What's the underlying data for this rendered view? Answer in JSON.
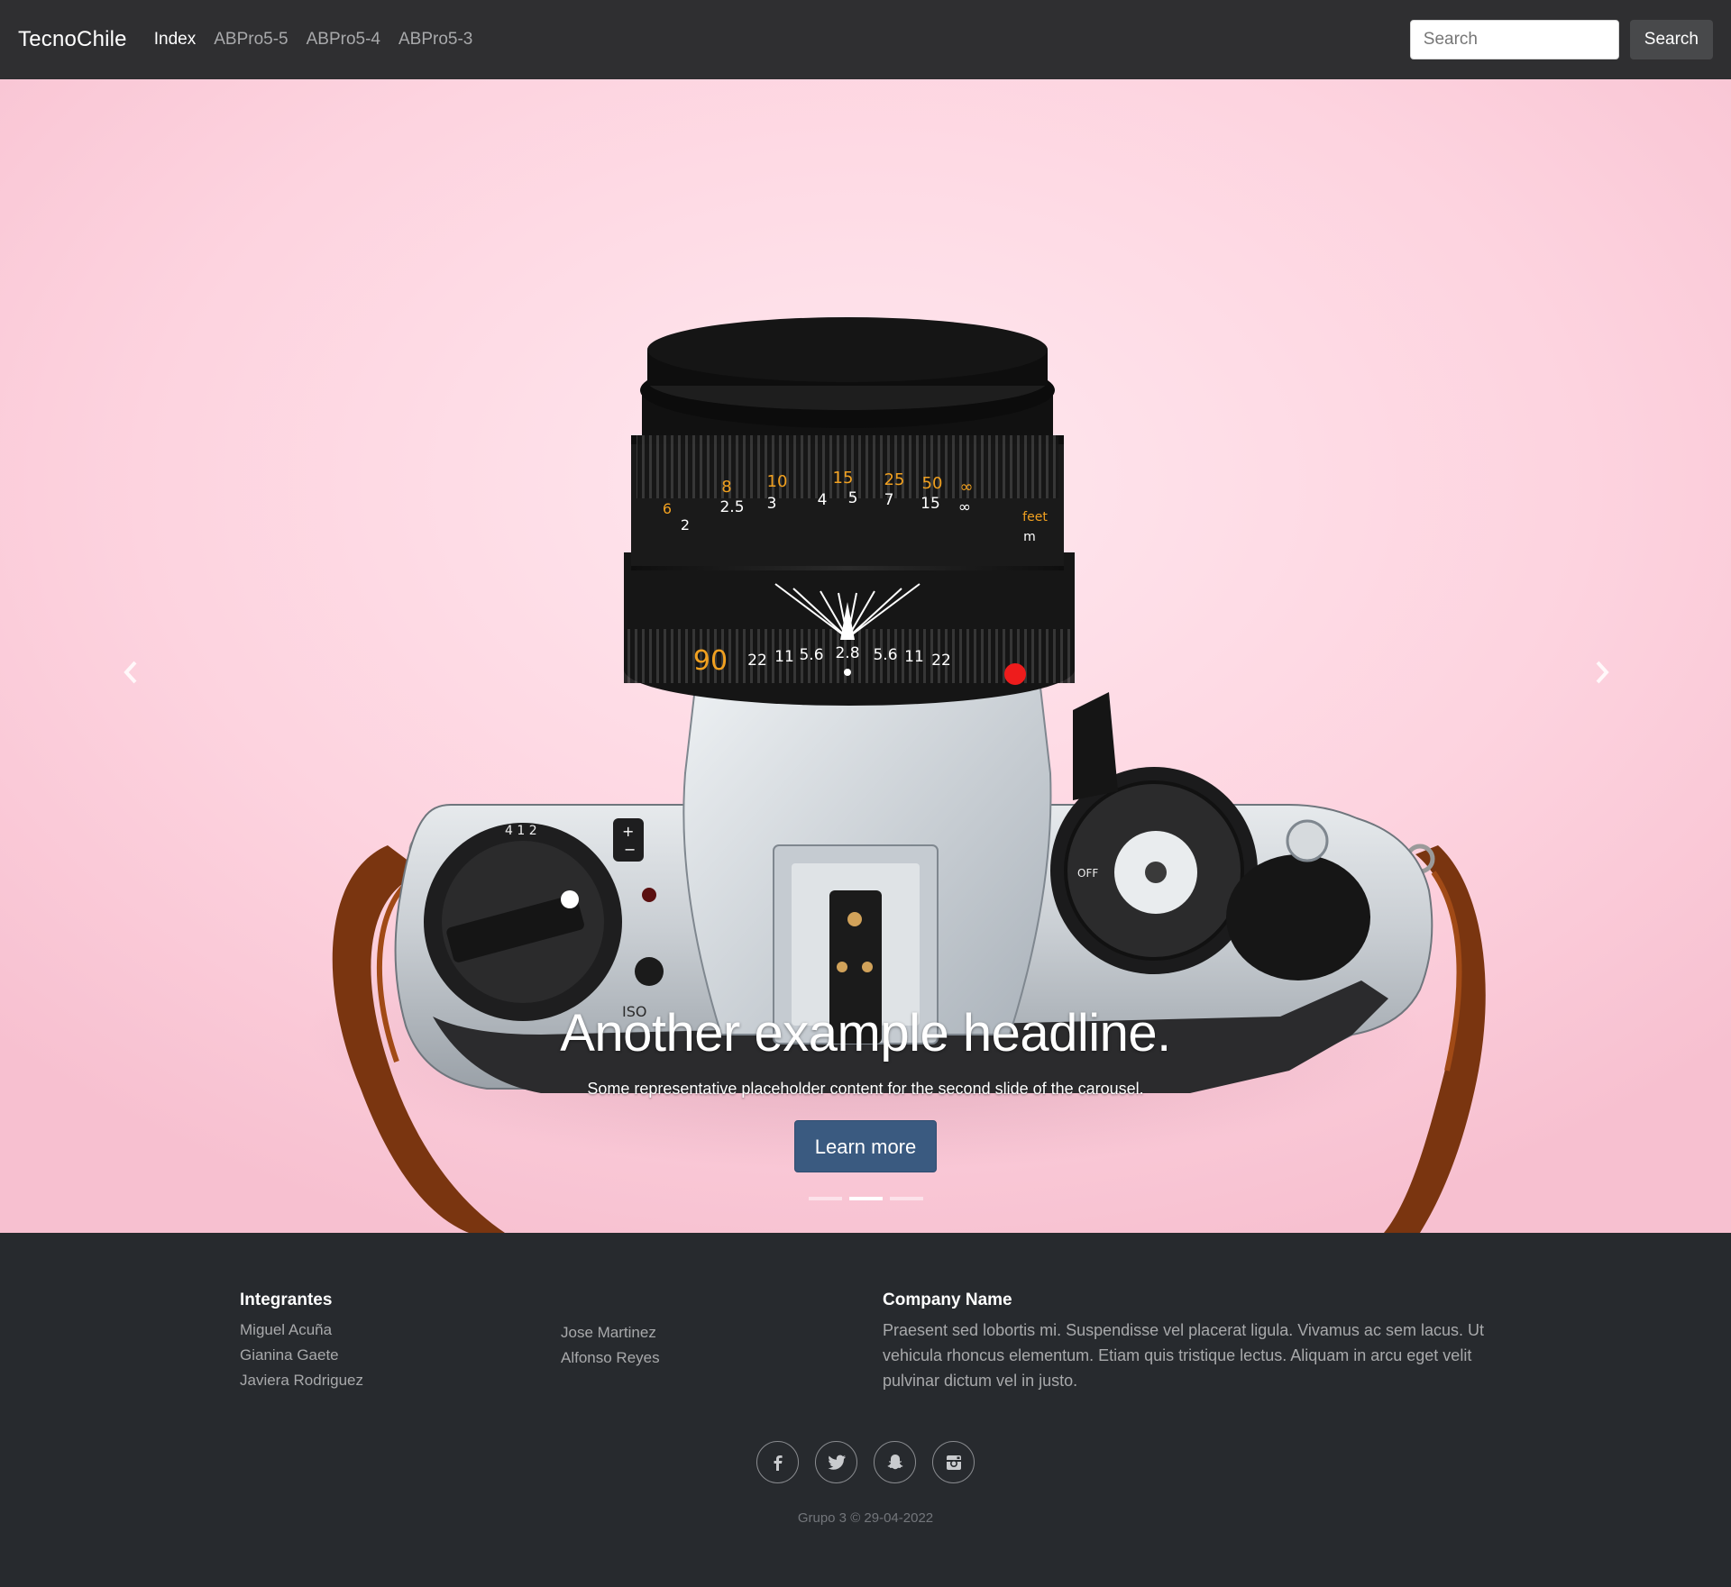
{
  "navbar": {
    "brand": "TecnoChile",
    "links": [
      {
        "label": "Index",
        "active": true
      },
      {
        "label": "ABPro5-5",
        "active": false
      },
      {
        "label": "ABPro5-4",
        "active": false
      },
      {
        "label": "ABPro5-3",
        "active": false
      }
    ],
    "search": {
      "placeholder": "Search",
      "value": "",
      "button_label": "Search"
    }
  },
  "carousel": {
    "headline": "Another example headline.",
    "text": "Some representative placeholder content for the second slide of the carousel.",
    "button_label": "Learn more",
    "slide_count": 3,
    "active_slide": 2,
    "prev_icon": "chevron-left-icon",
    "next_icon": "chevron-right-icon",
    "lens_markings": {
      "top_row": [
        "8",
        "10",
        "15",
        "25",
        "50",
        "∞"
      ],
      "mid_row": [
        "6",
        "2",
        "2.5",
        "3",
        "4",
        "5",
        "7",
        "15",
        "∞"
      ],
      "dof_row": [
        "22",
        "11",
        "5.6",
        "2.8",
        "5.6",
        "11",
        "22"
      ],
      "focal": "90",
      "units": [
        "feet",
        "m"
      ],
      "iso_label": "ISO",
      "off_label": "OFF"
    }
  },
  "footer": {
    "members_heading": "Integrantes",
    "members_col1": [
      "Miguel Acuña",
      "Gianina Gaete",
      "Javiera Rodriguez"
    ],
    "members_col2": [
      "Jose Martinez",
      "Alfonso Reyes"
    ],
    "company_heading": "Company Name",
    "company_text": "Praesent sed lobortis mi. Suspendisse vel placerat ligula. Vivamus ac sem lacus. Ut vehicula rhoncus elementum. Etiam quis tristique lectus. Aliquam in arcu eget velit pulvinar dictum vel in justo.",
    "social": [
      "facebook-icon",
      "twitter-icon",
      "snapchat-icon",
      "instagram-icon"
    ],
    "copyright": "Grupo 3 © 29-04-2022"
  },
  "colors": {
    "navbar_bg": "#2f2f31",
    "hero_bg": "#fcd3df",
    "button_primary": "#3a5a80",
    "footer_bg": "#272a2e",
    "lens_orange": "#f0a020",
    "red_dot": "#ee1c1c"
  }
}
